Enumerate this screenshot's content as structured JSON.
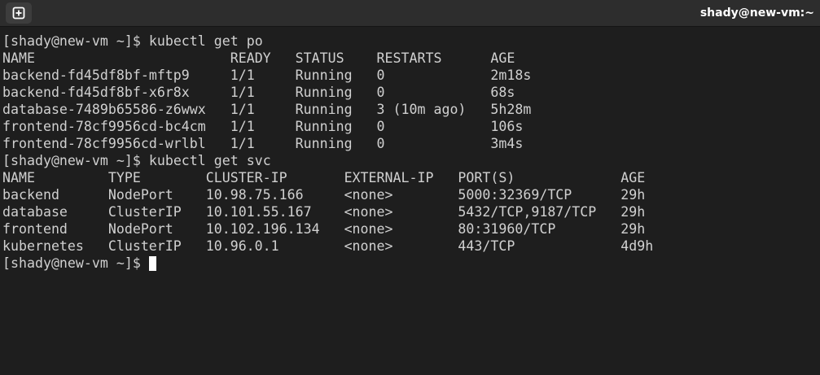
{
  "window": {
    "title": "shady@new-vm:~",
    "new_tab_icon": "plus-square-icon"
  },
  "terminal": {
    "prompt": "[shady@new-vm ~]$",
    "commands": {
      "get_pods": "kubectl get po",
      "get_services": "kubectl get svc"
    },
    "pods": {
      "headers": [
        "NAME",
        "READY",
        "STATUS",
        "RESTARTS",
        "AGE"
      ],
      "rows": [
        [
          "backend-fd45df8bf-mftp9",
          "1/1",
          "Running",
          "0",
          "2m18s"
        ],
        [
          "backend-fd45df8bf-x6r8x",
          "1/1",
          "Running",
          "0",
          "68s"
        ],
        [
          "database-7489b65586-z6wwx",
          "1/1",
          "Running",
          "3 (10m ago)",
          "5h28m"
        ],
        [
          "frontend-78cf9956cd-bc4cm",
          "1/1",
          "Running",
          "0",
          "106s"
        ],
        [
          "frontend-78cf9956cd-wrlbl",
          "1/1",
          "Running",
          "0",
          "3m4s"
        ]
      ]
    },
    "services": {
      "headers": [
        "NAME",
        "TYPE",
        "CLUSTER-IP",
        "EXTERNAL-IP",
        "PORT(S)",
        "AGE"
      ],
      "rows": [
        [
          "backend",
          "NodePort",
          "10.98.75.166",
          "<none>",
          "5000:32369/TCP",
          "29h"
        ],
        [
          "database",
          "ClusterIP",
          "10.101.55.167",
          "<none>",
          "5432/TCP,9187/TCP",
          "29h"
        ],
        [
          "frontend",
          "NodePort",
          "10.102.196.134",
          "<none>",
          "80:31960/TCP",
          "29h"
        ],
        [
          "kubernetes",
          "ClusterIP",
          "10.96.0.1",
          "<none>",
          "443/TCP",
          "4d9h"
        ]
      ]
    }
  },
  "colors": {
    "background": "#1e1e1e",
    "titlebar": "#2d2d2d",
    "text": "#d0d0d0",
    "cursor": "#ffffff"
  }
}
